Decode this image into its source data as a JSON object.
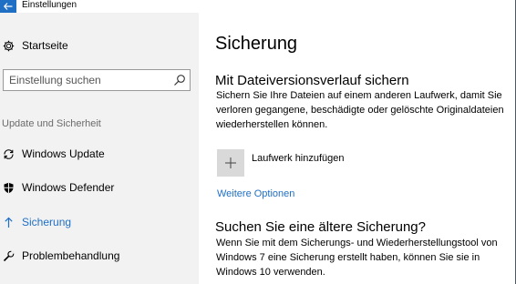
{
  "window": {
    "title": "Einstellungen"
  },
  "sidebar": {
    "home_label": "Startseite",
    "search_placeholder": "Einstellung suchen",
    "section_header": "Update und Sicherheit",
    "items": [
      {
        "label": "Windows Update",
        "icon": "refresh-icon"
      },
      {
        "label": "Windows Defender",
        "icon": "shield-icon"
      },
      {
        "label": "Sicherung",
        "icon": "backup-arrow-icon",
        "active": true
      },
      {
        "label": "Problembehandlung",
        "icon": "wrench-icon"
      }
    ]
  },
  "main": {
    "title": "Sicherung",
    "file_history": {
      "heading": "Mit Dateiversionsverlauf sichern",
      "description": "Sichern Sie Ihre Dateien auf einem anderen Laufwerk, damit Sie verloren gegangene, beschädigte oder gelöschte Originaldateien wiederherstellen können.",
      "add_drive_label": "Laufwerk hinzufügen",
      "more_options_link": "Weitere Optionen"
    },
    "older_backup": {
      "heading": "Suchen Sie eine ältere Sicherung?",
      "description": "Wenn Sie mit dem Sicherungs- und Wiederherstellungstool von Windows 7 eine Sicherung erstellt haben, können Sie sie in Windows 10 verwenden."
    }
  },
  "colors": {
    "accent": "#1f6fc5",
    "sidebar_bg": "#f2f2f2",
    "tile_bg": "#d9d9d9"
  }
}
